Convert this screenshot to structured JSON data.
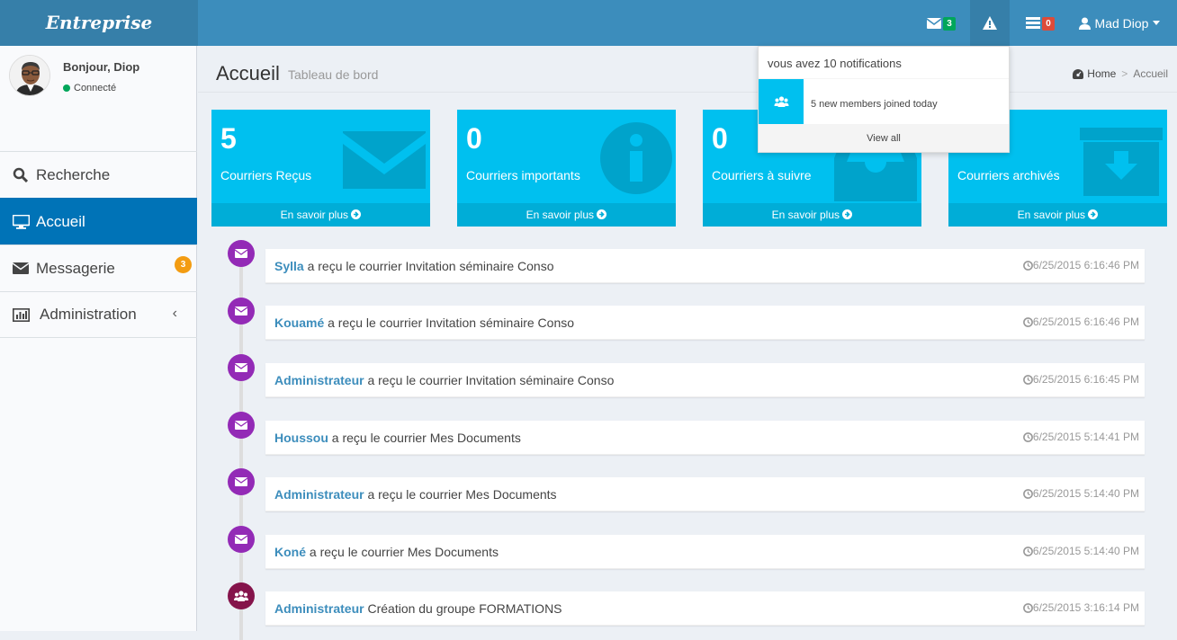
{
  "brand": "Entreprise",
  "navbar": {
    "messages_count": "3",
    "tasks_count": "0",
    "user_name": "Mad Diop"
  },
  "user_panel": {
    "greeting": "Bonjour, Diop",
    "status": "Connecté"
  },
  "sidebar": {
    "items": [
      {
        "label": "Recherche"
      },
      {
        "label": "Accueil"
      },
      {
        "label": "Messagerie",
        "badge": "3"
      },
      {
        "label": "Administration"
      }
    ]
  },
  "header": {
    "title": "Accueil",
    "subtitle": "Tableau de bord",
    "breadcrumb": [
      "Home",
      "Accueil"
    ]
  },
  "boxes": [
    {
      "count": "5",
      "label": "Courriers Reçus",
      "footer": "En savoir plus",
      "icon": "envelope-icon"
    },
    {
      "count": "0",
      "label": "Courriers importants",
      "footer": "En savoir plus",
      "icon": "info-icon"
    },
    {
      "count": "0",
      "label": "Courriers à suivre",
      "footer": "En savoir plus",
      "icon": "inbox-icon"
    },
    {
      "count": "",
      "label": "Courriers archivés",
      "footer": "En savoir plus",
      "icon": "archive-icon"
    }
  ],
  "timeline": [
    {
      "user": "Sylla",
      "text": "a reçu le courrier Invitation séminaire Conso",
      "time": "6/25/2015 6:16:46 PM",
      "icon": "envelope-icon"
    },
    {
      "user": "Kouamé",
      "text": "a reçu le courrier Invitation séminaire Conso",
      "time": "6/25/2015 6:16:46 PM",
      "icon": "envelope-icon"
    },
    {
      "user": "Administrateur",
      "text": "a reçu le courrier Invitation séminaire Conso",
      "time": "6/25/2015 6:16:45 PM",
      "icon": "envelope-icon"
    },
    {
      "user": "Houssou",
      "text": "a reçu le courrier Mes Documents",
      "time": "6/25/2015 5:14:41 PM",
      "icon": "envelope-icon"
    },
    {
      "user": "Administrateur",
      "text": "a reçu le courrier Mes Documents",
      "time": "6/25/2015 5:14:40 PM",
      "icon": "envelope-icon"
    },
    {
      "user": "Koné",
      "text": "a reçu le courrier Mes Documents",
      "time": "6/25/2015 5:14:40 PM",
      "icon": "envelope-icon"
    },
    {
      "user": "Administrateur",
      "text": "Création du groupe FORMATIONS",
      "time": "6/25/2015 3:16:14 PM",
      "icon": "users-icon"
    }
  ],
  "notifications": {
    "header": "vous avez 10 notifications",
    "items": [
      {
        "text": "5 new members joined today",
        "icon": "users-icon"
      }
    ],
    "footer": "View all"
  },
  "colors": {
    "topbar": "#3c8dbc",
    "brand_bg": "#367fa9",
    "box_aqua": "#00c0ef",
    "timeline_purple": "#932ab6",
    "timeline_maroon": "#85144b",
    "active_menu": "#0073b7"
  }
}
